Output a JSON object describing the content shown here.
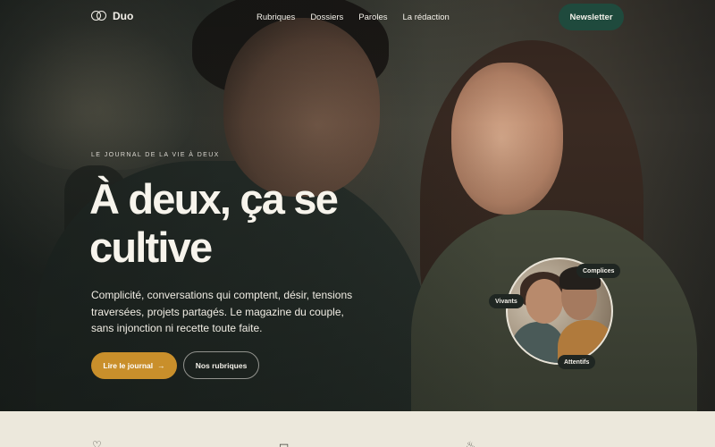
{
  "brand": {
    "name": "Duo",
    "logo_icon": "two-rings-icon"
  },
  "nav": {
    "items": [
      {
        "label": "Rubriques"
      },
      {
        "label": "Dossiers"
      },
      {
        "label": "Paroles"
      },
      {
        "label": "La rédaction"
      }
    ],
    "cta_label": "Newsletter"
  },
  "hero": {
    "eyebrow": "LE JOURNAL DE LA VIE À DEUX",
    "title": "À deux, ça se cultive",
    "lead": "Complicité, conversations qui comptent, désir, tensions traversées, projets partagés. Le magazine du couple, sans injonction ni recette toute faite.",
    "primary_cta": "Lire le journal",
    "primary_cta_icon": "arrow-right-icon",
    "secondary_cta": "Nos rubriques",
    "chips": [
      "Complices",
      "Vivants",
      "Attentifs"
    ]
  },
  "features": {
    "icons": [
      "heart-icon",
      "chat-bubble-icon",
      "flame-icon"
    ]
  },
  "colors": {
    "accent": "#c98f2b",
    "nav_button": "#1f4a3d",
    "strip_background": "#ece8dc"
  }
}
